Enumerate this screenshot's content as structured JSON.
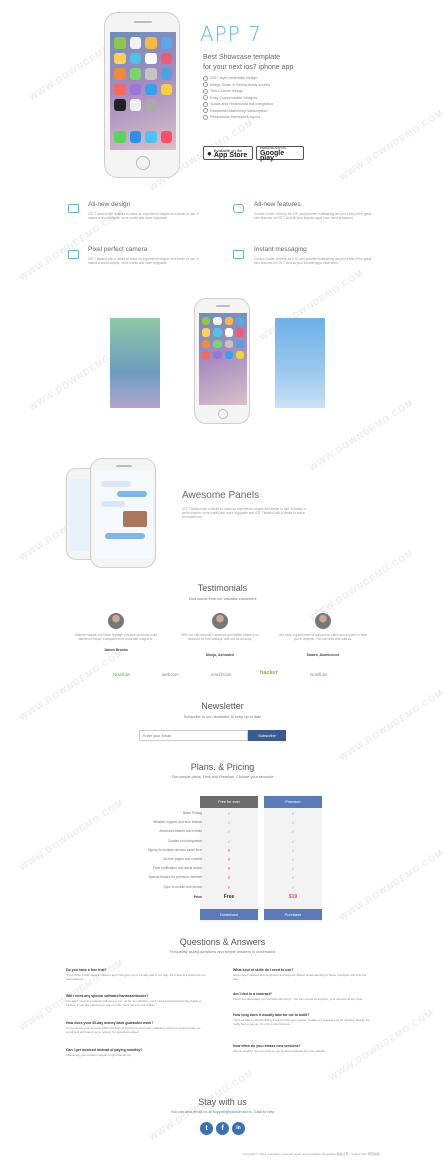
{
  "hero": {
    "title": "APP 7",
    "subtitle_line1": "Best Showcase template",
    "subtitle_line2": "for your next ios7 iphone app",
    "features": [
      "iOS7 style minimalist design",
      "Image Slider & Retina ready screen",
      "Two Column design",
      "Easy Customizable Widgets",
      "Social and Testimonial link integration",
      "Newsletter/Mailchimp subscription",
      "Responsive framework layout"
    ],
    "appstore_small": "Available on the",
    "appstore_big": "App Store",
    "googleplay_small": "ANDROID APP ON",
    "googleplay_big": "Google play"
  },
  "features": [
    {
      "title": "All-new design",
      "text": "iOS 7 started with a desire to make an experience simpler and easier to use. It makes a world simpler, more useful and more enjoyable.",
      "icon": "image-icon"
    },
    {
      "title": "All-new features",
      "text": "Control Center. AirDrop for iOS, and smarter multitasking are just a few of the great new features in iOS 7. And all your favorite apps have been enhanced.",
      "icon": "chat-icon"
    },
    {
      "title": "Pixel perfect camera",
      "text": "iOS 7 started with a desire to make an experience simpler and easier to use. It makes a world simpler, more useful and more enjoyable.",
      "icon": "camera-icon"
    },
    {
      "title": "Instant messaging",
      "text": "Control Center. AirDrop for iOS, and smarter multitasking are just a few of the great new features in iOS 7. And all your favorite apps have been.",
      "icon": "mail-icon"
    }
  ],
  "panels": {
    "title": "Awesome Panels",
    "text": "iOS 7 started with a desire to make an experience simpler and easier to use. It makes a world simpler, more useful and more enjoyable and iOS 7 started with a desire to make an experience."
  },
  "testimonials": {
    "title": "Testimonials",
    "subtitle": "Kind words from our valuable customers",
    "items": [
      {
        "quote": "Maecen lacinia orci fusce highagh posuere sed nunc nulla laoreet ut neque a aliquam enim nunc sed magna id.",
        "name": "James Brooks"
      },
      {
        "quote": "With our call recorder's services and stylish tables your discount for the holidays, with our sit-uma bly.",
        "name": "Monju, Ashraden"
      },
      {
        "quote": "We have a great team of support for sales and support to help you in anytime. You can also visit with us.",
        "name": "Swaeo, Aluminence"
      }
    ],
    "logos": [
      "Nowfidet",
      "webcom",
      "intu@com",
      "hacker",
      "Nowfidet"
    ]
  },
  "newsletter": {
    "title": "Newsletter",
    "subtitle": "Subscribe to our newsletter to keep up to date",
    "placeholder": "Enter your Email",
    "button": "Subscribe"
  },
  "pricing": {
    "title": "Plans. & Pricing",
    "subtitle": "Two simple plans, Free and Premium. Choose your favourite",
    "col_free": "Free for ever",
    "col_premium": "Premium",
    "rows": [
      {
        "label": "Basic Pricing",
        "free": "yes",
        "premium": "yes"
      },
      {
        "label": "Weather support and time feature",
        "free": "yes",
        "premium": "yes"
      },
      {
        "label": "Advanced search and results",
        "free": "yes",
        "premium": "yes"
      },
      {
        "label": "Custom font integration",
        "free": "yes",
        "premium": "yes"
      },
      {
        "label": "Signup to multiple devices same time",
        "free": "no",
        "premium": "yes"
      },
      {
        "label": "Ad free pages and content",
        "free": "no",
        "premium": "yes"
      },
      {
        "label": "Push notification and alerts action",
        "free": "no",
        "premium": "yes"
      },
      {
        "label": "Special feature for premium member",
        "free": "no",
        "premium": "yes"
      },
      {
        "label": "Sync to mobile and device",
        "free": "no",
        "premium": "yes"
      }
    ],
    "price_label": "Price",
    "price_free": "Free",
    "price_premium": "$19",
    "btn_free": "Download",
    "btn_premium": "Purchase"
  },
  "faq": {
    "title": "Questions & Answers",
    "subtitle": "Frequently asked questions and simple answers to understand",
    "left": [
      {
        "q": "Do you have a free trial?",
        "a": "If you'd like a trial, please visit our app? We give you a 14-day trial of our app. Be it free to experience the best features."
      },
      {
        "q": "Will I need any special software/hardware/books?",
        "a": "You don't need any special software to run. As far as software, you'll need a web-browser like Safari or Firefox. If you are planning to use on iOS, you'll need to use a Mac."
      },
      {
        "q": "How does your 30-day money back guarantee work?",
        "a": "If you cancel your account within 30 days of signing up and aren't satisfied, send our support team an email and we'll send you a refund. No questions asked."
      },
      {
        "q": "Can I get invoiced instead of paying monthly?",
        "a": "Absolutely, just contact support to get that set up."
      }
    ],
    "right": [
      {
        "q": "What kind of skills do I need to use?",
        "a": "Some App7 started with beginners and experts. Better understanding of these principles will help the way."
      },
      {
        "q": "Am I tied to a contract?",
        "a": "There are absolutely no contracts with App7. You can cancel at anytime, your account at any time."
      },
      {
        "q": "How long does it usually take for me to build?",
        "a": "You'll be able to start building the app once you register. It takes on average just 30 minutes. Really, it's really fast to set up. It's only a few minutes."
      },
      {
        "q": "How often do you release new versions?",
        "a": "Almost weekly! You can refer to our version roadmap for more details."
      }
    ]
  },
  "footer": {
    "title": "Stay with us",
    "text_prefix": "You can also email us at",
    "email": "support@youdomain.io",
    "text_suffix": ". Glad to help",
    "social": [
      {
        "icon": "twitter-icon",
        "glyph": "t"
      },
      {
        "icon": "facebook-icon",
        "glyph": "f"
      },
      {
        "icon": "linkedin-icon",
        "glyph": "in"
      }
    ],
    "copyright": "Copyright © 2013. Company name All rights reserved.More Templates 模板之家 - Collect from 网页模板"
  },
  "watermark": "WWW.DOWNDEMO.COM",
  "colors": {
    "accent": "#5fb3e6",
    "header_gray": "#6d6d6d",
    "premium": "#5a7bb7",
    "yes": "#5cb85c",
    "no": "#e74c6a"
  }
}
